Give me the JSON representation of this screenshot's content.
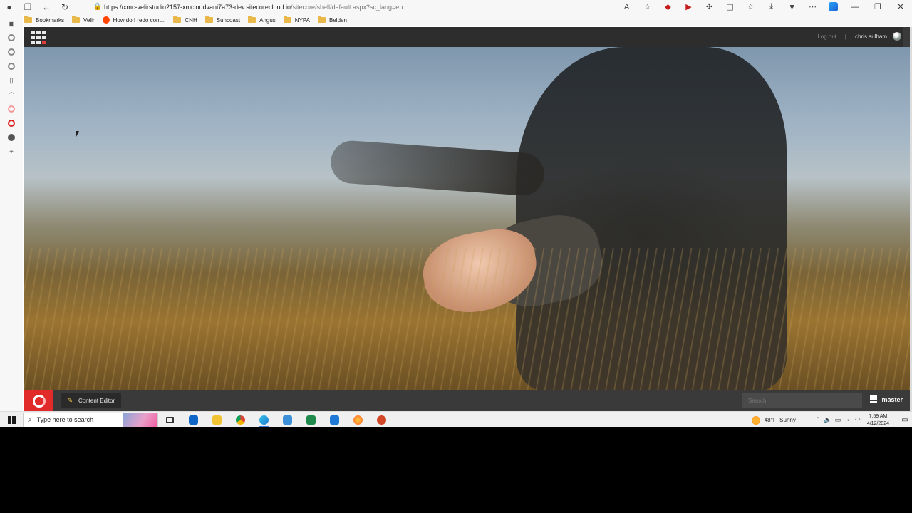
{
  "browser": {
    "url_host": "https://xmc-velirstudio2157-xmcloudvani7a73-dev.sitecorecloud.io",
    "url_path": "/sitecore/shell/default.aspx?sc_lang=en",
    "bookmarks": [
      {
        "label": "Bookmarks",
        "type": "folder"
      },
      {
        "label": "Velir",
        "type": "folder"
      },
      {
        "label": "How do I redo cont...",
        "type": "reddit"
      },
      {
        "label": "CNH",
        "type": "folder"
      },
      {
        "label": "Suncoast",
        "type": "folder"
      },
      {
        "label": "Angus",
        "type": "folder"
      },
      {
        "label": "NYPA",
        "type": "folder"
      },
      {
        "label": "Belden",
        "type": "folder"
      }
    ]
  },
  "sitecore": {
    "header": {
      "logout_label": "Log out",
      "separator": "|",
      "username": "chris.sulham"
    },
    "footer": {
      "app_label": "Content Editor",
      "search_placeholder": "Search",
      "database": "master"
    }
  },
  "taskbar": {
    "search_placeholder": "Type here to search",
    "weather_temp": "48°F",
    "weather_desc": "Sunny",
    "time": "7:59 AM",
    "date": "4/12/2024"
  },
  "colors": {
    "sitecore_red": "#e12b2b",
    "sitecore_dark": "#2d2d2d"
  }
}
